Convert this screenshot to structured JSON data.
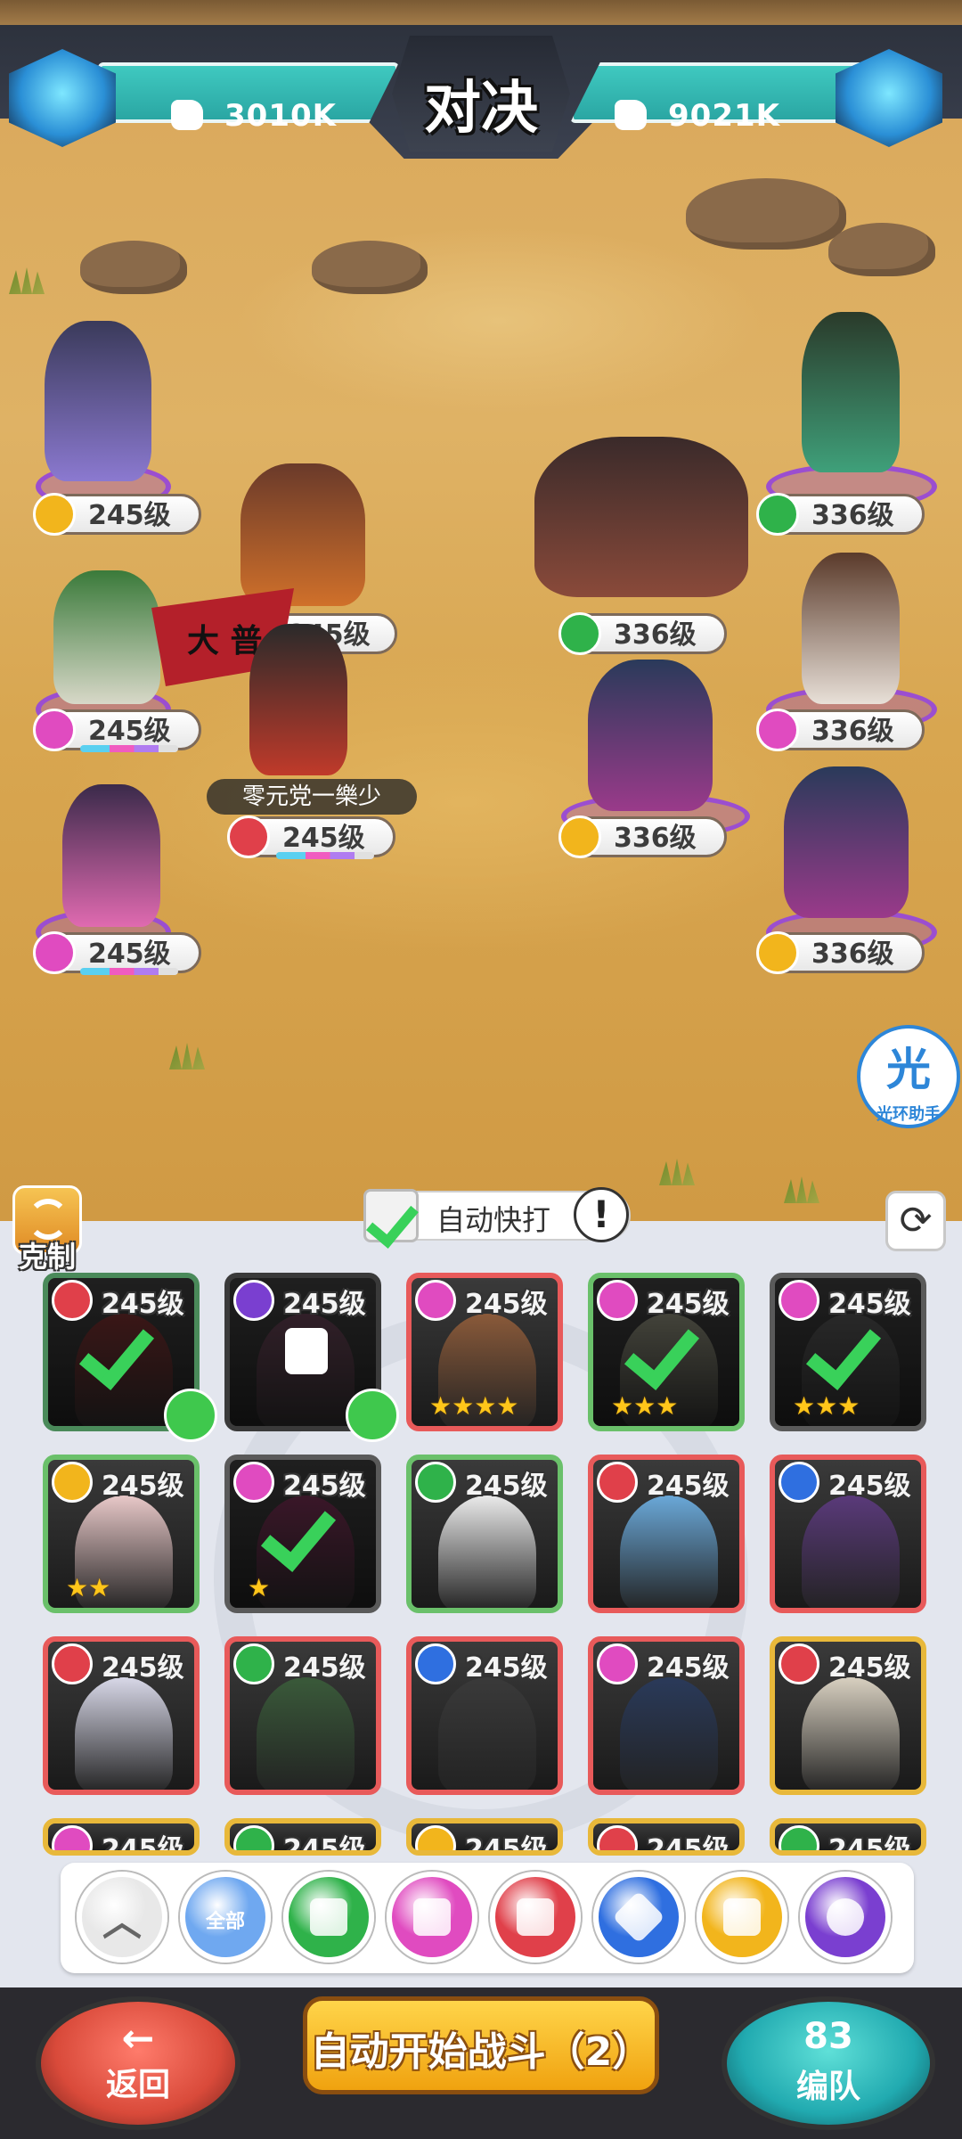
{
  "topbar": {
    "title": "对决",
    "left_power": "3010K",
    "right_power": "9021K"
  },
  "battlefield": {
    "player_name": "零元党一樂少",
    "banner_text": "大 普",
    "allies": [
      {
        "level": "245级",
        "faction": "sun"
      },
      {
        "level": "245级",
        "faction": "none"
      },
      {
        "level": "245级",
        "faction": "heart"
      },
      {
        "level": "245级",
        "faction": "club"
      },
      {
        "level": "245级",
        "faction": "heart"
      }
    ],
    "enemies": [
      {
        "level": "336级",
        "faction": "spade"
      },
      {
        "level": "336级",
        "faction": "spade"
      },
      {
        "level": "336级",
        "faction": "heart"
      },
      {
        "level": "336级",
        "faction": "sun"
      },
      {
        "level": "336级",
        "faction": "sun"
      }
    ]
  },
  "helper": {
    "glyph": "光",
    "label": "光环助手"
  },
  "panel": {
    "counter_label": "克制",
    "auto_label": "自动快打",
    "auto_checked": true,
    "alert_glyph": "!"
  },
  "cards": [
    {
      "level": "245级",
      "faction": "club",
      "selected": true,
      "stars": "",
      "user": true,
      "locked": false
    },
    {
      "level": "245级",
      "faction": "moon",
      "selected": false,
      "stars": "",
      "user": true,
      "locked": true
    },
    {
      "level": "245级",
      "faction": "heart",
      "selected": false,
      "stars": "★★★★",
      "user": false,
      "locked": false
    },
    {
      "level": "245级",
      "faction": "heart",
      "selected": true,
      "stars": "★★★",
      "user": false,
      "locked": false
    },
    {
      "level": "245级",
      "faction": "heart",
      "selected": true,
      "stars": "★★★",
      "user": false,
      "locked": false
    },
    {
      "level": "245级",
      "faction": "sun",
      "selected": false,
      "stars": "★★",
      "user": false,
      "locked": false
    },
    {
      "level": "245级",
      "faction": "heart",
      "selected": true,
      "stars": "★",
      "user": false,
      "locked": false
    },
    {
      "level": "245级",
      "faction": "spade",
      "selected": false,
      "stars": "",
      "user": false,
      "locked": false
    },
    {
      "level": "245级",
      "faction": "club",
      "selected": false,
      "stars": "",
      "user": false,
      "locked": false
    },
    {
      "level": "245级",
      "faction": "diamond",
      "selected": false,
      "stars": "",
      "user": false,
      "locked": false
    },
    {
      "level": "245级",
      "faction": "club",
      "selected": false,
      "stars": "",
      "user": false,
      "locked": false
    },
    {
      "level": "245级",
      "faction": "spade",
      "selected": false,
      "stars": "",
      "user": false,
      "locked": false
    },
    {
      "level": "245级",
      "faction": "diamond",
      "selected": false,
      "stars": "",
      "user": false,
      "locked": false
    },
    {
      "level": "245级",
      "faction": "heart",
      "selected": false,
      "stars": "",
      "user": false,
      "locked": false
    },
    {
      "level": "245级",
      "faction": "club",
      "selected": false,
      "stars": "",
      "user": false,
      "locked": false
    },
    {
      "level": "245级",
      "faction": "heart",
      "selected": false,
      "stars": "",
      "user": false,
      "locked": false
    },
    {
      "level": "245级",
      "faction": "spade",
      "selected": false,
      "stars": "",
      "user": false,
      "locked": false
    },
    {
      "level": "245级",
      "faction": "sun",
      "selected": false,
      "stars": "",
      "user": false,
      "locked": false
    },
    {
      "level": "245级",
      "faction": "club",
      "selected": false,
      "stars": "",
      "user": false,
      "locked": false
    },
    {
      "level": "245级",
      "faction": "spade",
      "selected": false,
      "stars": "",
      "user": false,
      "locked": false
    }
  ],
  "filters": [
    {
      "name": "collapse",
      "label": "︿",
      "color": "#e8e8e8"
    },
    {
      "name": "all",
      "label": "全部",
      "color": "#6fa8f0"
    },
    {
      "name": "spade",
      "label": "",
      "color": "#2fb24a"
    },
    {
      "name": "heart",
      "label": "",
      "color": "#e04bc0"
    },
    {
      "name": "club",
      "label": "",
      "color": "#e0404a"
    },
    {
      "name": "diamond",
      "label": "",
      "color": "#2f6fe0"
    },
    {
      "name": "sun",
      "label": "",
      "color": "#f2b51c"
    },
    {
      "name": "moon",
      "label": "",
      "color": "#7a3fd0"
    }
  ],
  "faction_colors": {
    "sun": "#f2b51c",
    "heart": "#e04bc0",
    "club": "#e0404a",
    "spade": "#2fb24a",
    "diamond": "#2f6fe0",
    "moon": "#7a3fd0",
    "none": "#bbbbbb"
  },
  "bottombar": {
    "back_label": "返回",
    "back_arrow": "←",
    "start_label": "自动开始战斗（2）",
    "team_icon": "83",
    "team_label": "编队"
  }
}
